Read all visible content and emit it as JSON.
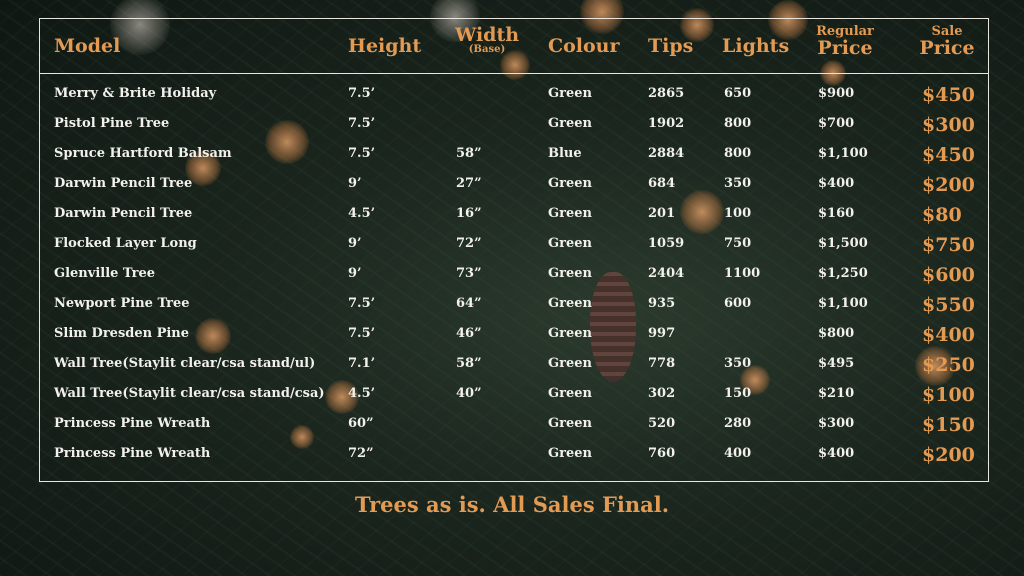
{
  "headers": {
    "model": "Model",
    "height": "Height",
    "width_main": "Width",
    "width_sub": "(Base)",
    "colour": "Colour",
    "tips": "Tips",
    "lights": "Lights",
    "regular_top": "Regular",
    "regular_bottom": "Price",
    "sale_top": "Sale",
    "sale_bottom": "Price"
  },
  "rows": [
    {
      "model": "Merry & Brite Holiday",
      "height": "7.5’",
      "width": "",
      "colour": "Green",
      "tips": "2865",
      "lights": "650",
      "regular": "$900",
      "sale": "$450"
    },
    {
      "model": "Pistol Pine Tree",
      "height": "7.5’",
      "width": "",
      "colour": "Green",
      "tips": "1902",
      "lights": "800",
      "regular": "$700",
      "sale": "$300"
    },
    {
      "model": "Spruce Hartford Balsam",
      "height": "7.5’",
      "width": "58”",
      "colour": "Blue",
      "tips": "2884",
      "lights": "800",
      "regular": "$1,100",
      "sale": "$450"
    },
    {
      "model": "Darwin Pencil Tree",
      "height": "9’",
      "width": "27”",
      "colour": "Green",
      "tips": "684",
      "lights": "350",
      "regular": "$400",
      "sale": "$200"
    },
    {
      "model": "Darwin Pencil Tree",
      "height": "4.5’",
      "width": "16”",
      "colour": "Green",
      "tips": "201",
      "lights": "100",
      "regular": "$160",
      "sale": "$80"
    },
    {
      "model": "Flocked Layer Long",
      "height": "9’",
      "width": "72”",
      "colour": "Green",
      "tips": "1059",
      "lights": "750",
      "regular": "$1,500",
      "sale": "$750"
    },
    {
      "model": "Glenville Tree",
      "height": "9’",
      "width": "73”",
      "colour": "Green",
      "tips": "2404",
      "lights": "1100",
      "regular": "$1,250",
      "sale": "$600"
    },
    {
      "model": "Newport Pine Tree",
      "height": "7.5’",
      "width": "64”",
      "colour": "Green",
      "tips": "935",
      "lights": "600",
      "regular": "$1,100",
      "sale": "$550"
    },
    {
      "model": "Slim Dresden Pine",
      "height": "7.5’",
      "width": "46”",
      "colour": "Green",
      "tips": "997",
      "lights": "",
      "regular": "$800",
      "sale": "$400"
    },
    {
      "model": "Wall Tree(Staylit clear/csa stand/ul)",
      "height": "7.1’",
      "width": "58”",
      "colour": "Green",
      "tips": "778",
      "lights": "350",
      "regular": "$495",
      "sale": "$250"
    },
    {
      "model": "Wall Tree(Staylit clear/csa stand/csa)",
      "height": "4.5’",
      "width": "40”",
      "colour": "Green",
      "tips": "302",
      "lights": "150",
      "regular": "$210",
      "sale": "$100"
    },
    {
      "model": "Princess Pine Wreath",
      "height": "60”",
      "width": "",
      "colour": "Green",
      "tips": "520",
      "lights": "280",
      "regular": "$300",
      "sale": "$150"
    },
    {
      "model": "Princess Pine Wreath",
      "height": "72”",
      "width": "",
      "colour": "Green",
      "tips": "760",
      "lights": "400",
      "regular": "$400",
      "sale": "$200"
    }
  ],
  "footer": "Trees as is. All Sales Final.",
  "colors": {
    "accent": "#e39a53",
    "text": "#f3f1ec",
    "border": "#e9e6e0"
  }
}
